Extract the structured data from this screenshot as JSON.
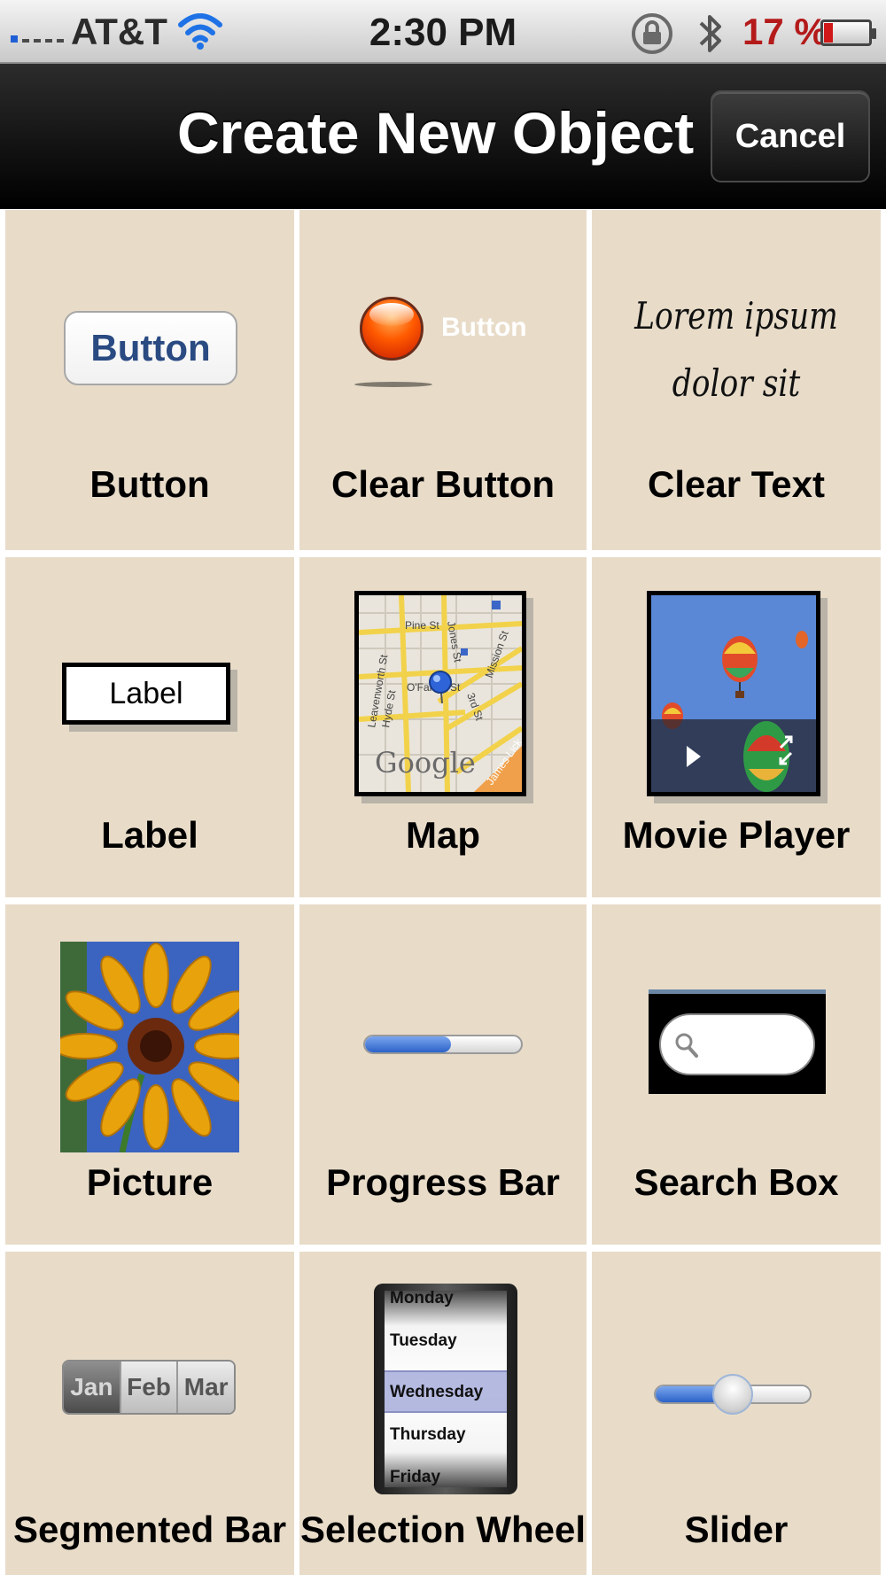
{
  "status_bar": {
    "carrier": "AT&T",
    "time": "2:30 PM",
    "battery_percent": "17 %",
    "battery_level": 0.17
  },
  "nav_bar": {
    "title": "Create New Object",
    "cancel_label": "Cancel"
  },
  "objects": [
    {
      "label": "Button",
      "preview_text": "Button",
      "icon": "rounded-button-preview"
    },
    {
      "label": "Clear Button",
      "preview_text": "Button",
      "icon": "orb-button-preview"
    },
    {
      "label": "Clear Text",
      "preview_text": "Lorem ipsum dolor sit",
      "icon": "text-preview"
    },
    {
      "label": "Label",
      "preview_text": "Label",
      "icon": "label-preview"
    },
    {
      "label": "Map",
      "preview_text": "Google",
      "icon": "map-preview"
    },
    {
      "label": "Movie Player",
      "icon": "movie-player-preview"
    },
    {
      "label": "Picture",
      "icon": "flower-picture-preview"
    },
    {
      "label": "Progress Bar",
      "progress": 0.55,
      "icon": "progress-bar-preview"
    },
    {
      "label": "Search Box",
      "icon": "search-box-preview"
    },
    {
      "label": "Segmented Bar",
      "segments": [
        "Jan",
        "Feb",
        "Mar"
      ],
      "icon": "segmented-control-preview"
    },
    {
      "label": "Selection Wheel",
      "options": [
        "Monday",
        "Tuesday",
        "Wednesday",
        "Thursday",
        "Friday"
      ],
      "selected": "Wednesday",
      "icon": "picker-wheel-preview"
    },
    {
      "label": "Slider",
      "value": 0.5,
      "icon": "slider-preview"
    }
  ],
  "map_streets": [
    "Pine St",
    "Leavenworth St",
    "Hyde St",
    "O'Farrell St",
    "Mission St",
    "Jones St",
    "3rd St",
    "James Lick"
  ],
  "colors": {
    "cell_background": "#e8dcc9",
    "nav_background": "#000000",
    "accent_blue": "#2c62c8",
    "battery_low": "#b41a1a"
  }
}
